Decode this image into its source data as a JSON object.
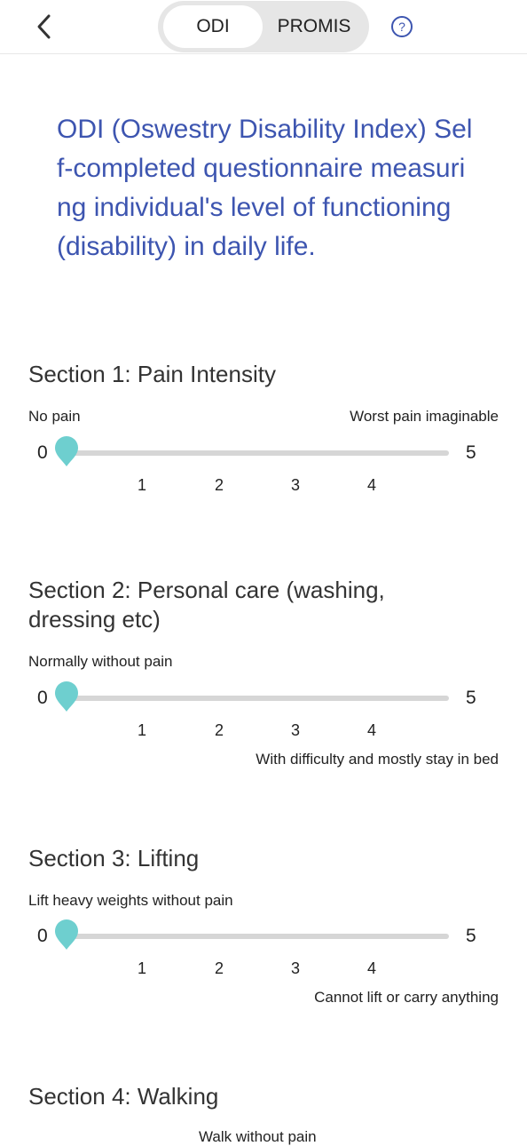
{
  "header": {
    "tabs": [
      {
        "label": "ODI",
        "active": true
      },
      {
        "label": "PROMIS",
        "active": false
      }
    ],
    "icons": {
      "back": "chevron-left-icon",
      "help": "question-circle-icon"
    },
    "accent_color": "#3d55b0"
  },
  "intro": "ODI (Oswestry Disability Index) Self-completed questionnaire measuring individual's level of functioning (disability) in daily life.",
  "slider_color": "#6ecfcf",
  "sections": [
    {
      "title": "Section 1: Pain Intensity",
      "min_label": "No pain",
      "max_label": "Worst pain imaginable",
      "min": "0",
      "max": "5",
      "ticks": [
        "1",
        "2",
        "3",
        "4"
      ],
      "value": 0
    },
    {
      "title": "Section 2: Personal care (washing, dressing etc)",
      "min_label": "Normally without pain",
      "max_label": "With difficulty and mostly stay in bed",
      "min": "0",
      "max": "5",
      "ticks": [
        "1",
        "2",
        "3",
        "4"
      ],
      "value": 0
    },
    {
      "title": "Section 3: Lifting",
      "min_label": "Lift heavy weights without pain",
      "max_label": "Cannot lift or carry anything",
      "min": "0",
      "max": "5",
      "ticks": [
        "1",
        "2",
        "3",
        "4"
      ],
      "value": 0
    },
    {
      "title": "Section 4: Walking",
      "min_label": "Walk without pain"
    }
  ]
}
